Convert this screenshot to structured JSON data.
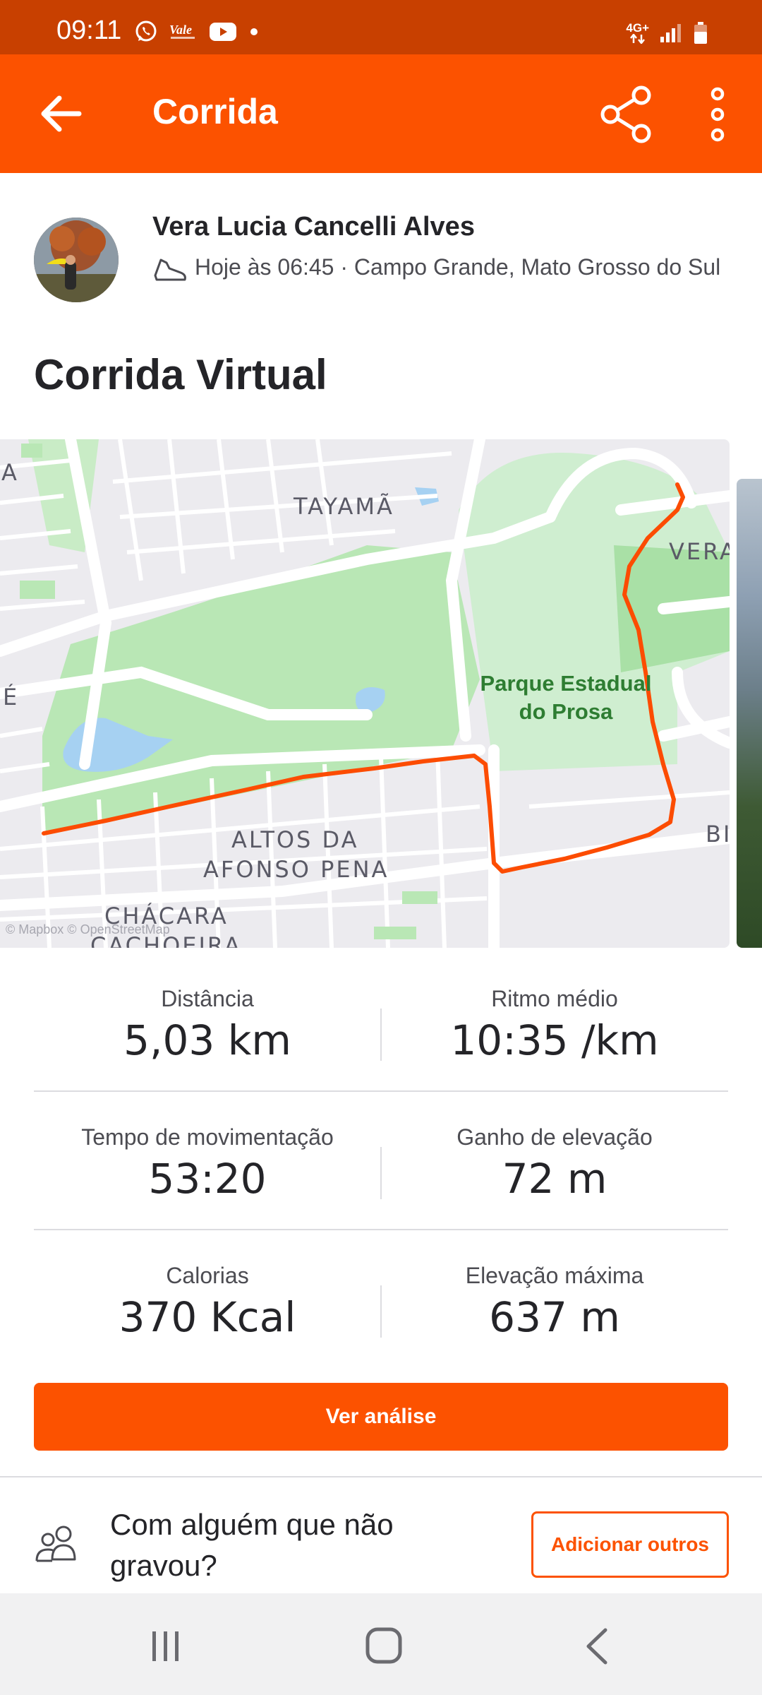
{
  "status_bar": {
    "time": "09:11",
    "network": "4G+",
    "icons": [
      "whatsapp-icon",
      "vale-app-icon",
      "youtube-icon",
      "notification-dot-icon",
      "signal-icon",
      "battery-icon"
    ]
  },
  "app_bar": {
    "title": "Corrida",
    "icons": [
      "back-arrow-icon",
      "share-icon",
      "more-vert-icon"
    ],
    "background": "#fc5200"
  },
  "activity": {
    "athlete_name": "Vera Lucia Cancelli Alves",
    "meta": "Hoje às 06:45 · Campo Grande, Mato Grosso do Sul",
    "title": "Corrida Virtual"
  },
  "map": {
    "labels": {
      "tayama": "TAYAMÃ",
      "altos1": "ALTOS DA",
      "altos2": "AFONSO PENA",
      "chacara1": "CHÁCARA",
      "chacara2": "CACHOEIRA",
      "vera": "VERA",
      "park1": "Parque Estadual",
      "park2": "do Prosa",
      "edge_a": "A",
      "edge_e": "É",
      "edge_b": "BI"
    },
    "attribution": "© Mapbox © OpenStreetMap",
    "route_color": "#fc4c02"
  },
  "stats": [
    {
      "left": {
        "label": "Distância",
        "value": "5,03 km"
      },
      "right": {
        "label": "Ritmo médio",
        "value": "10:35 /km"
      }
    },
    {
      "left": {
        "label": "Tempo de movimentação",
        "value": "53:20"
      },
      "right": {
        "label": "Ganho de elevação",
        "value": "72 m"
      }
    },
    {
      "left": {
        "label": "Calorias",
        "value": "370 Kcal"
      },
      "right": {
        "label": "Elevação máxima",
        "value": "637 m"
      }
    }
  ],
  "analysis_button": "Ver análise",
  "tag_section": {
    "text": "Com alguém que não gravou?",
    "button": "Adicionar outros"
  },
  "nav_bar": {
    "icons": [
      "recent-apps-icon",
      "home-icon",
      "back-icon"
    ]
  }
}
